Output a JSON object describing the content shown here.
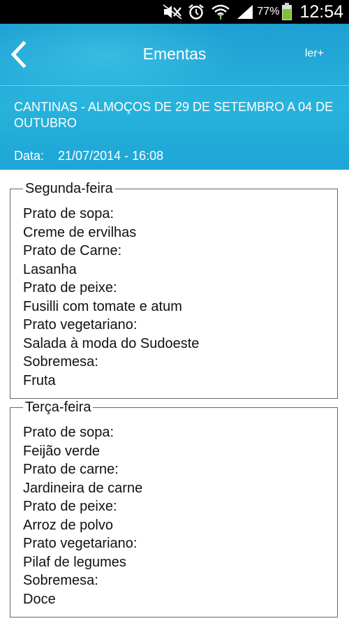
{
  "status_bar": {
    "battery_percent": "77%",
    "clock": "12:54",
    "icons": [
      "mute-icon",
      "alarm-icon",
      "wifi-icon",
      "signal-icon",
      "battery-icon"
    ]
  },
  "header": {
    "back_icon": "chevron-left-icon",
    "title": "Ementas",
    "action_label": "ler+",
    "menu_title": "CANTINAS - ALMOÇOS DE 29 DE SETEMBRO A 04 DE OUTUBRO",
    "date_label": "Data:",
    "date_value": "21/07/2014 - 16:08",
    "gradient_colors": [
      "#1f9fd2",
      "#27b3dc",
      "#1ea5d6"
    ]
  },
  "days": [
    {
      "name": "Segunda-feira",
      "items": [
        "Prato de sopa:",
        "Creme de ervilhas",
        "Prato de Carne:",
        "Lasanha",
        "Prato de peixe:",
        "Fusilli com tomate e atum",
        "Prato vegetariano:",
        "Salada à moda do Sudoeste",
        "Sobremesa:",
        "Fruta"
      ]
    },
    {
      "name": "Terça-feira",
      "items": [
        "Prato de sopa:",
        "Feijão verde",
        "Prato de carne:",
        "Jardineira de carne",
        "Prato de peixe:",
        "Arroz de polvo",
        "Prato vegetariano:",
        "Pilaf de legumes",
        "Sobremesa:",
        "Doce"
      ]
    }
  ]
}
